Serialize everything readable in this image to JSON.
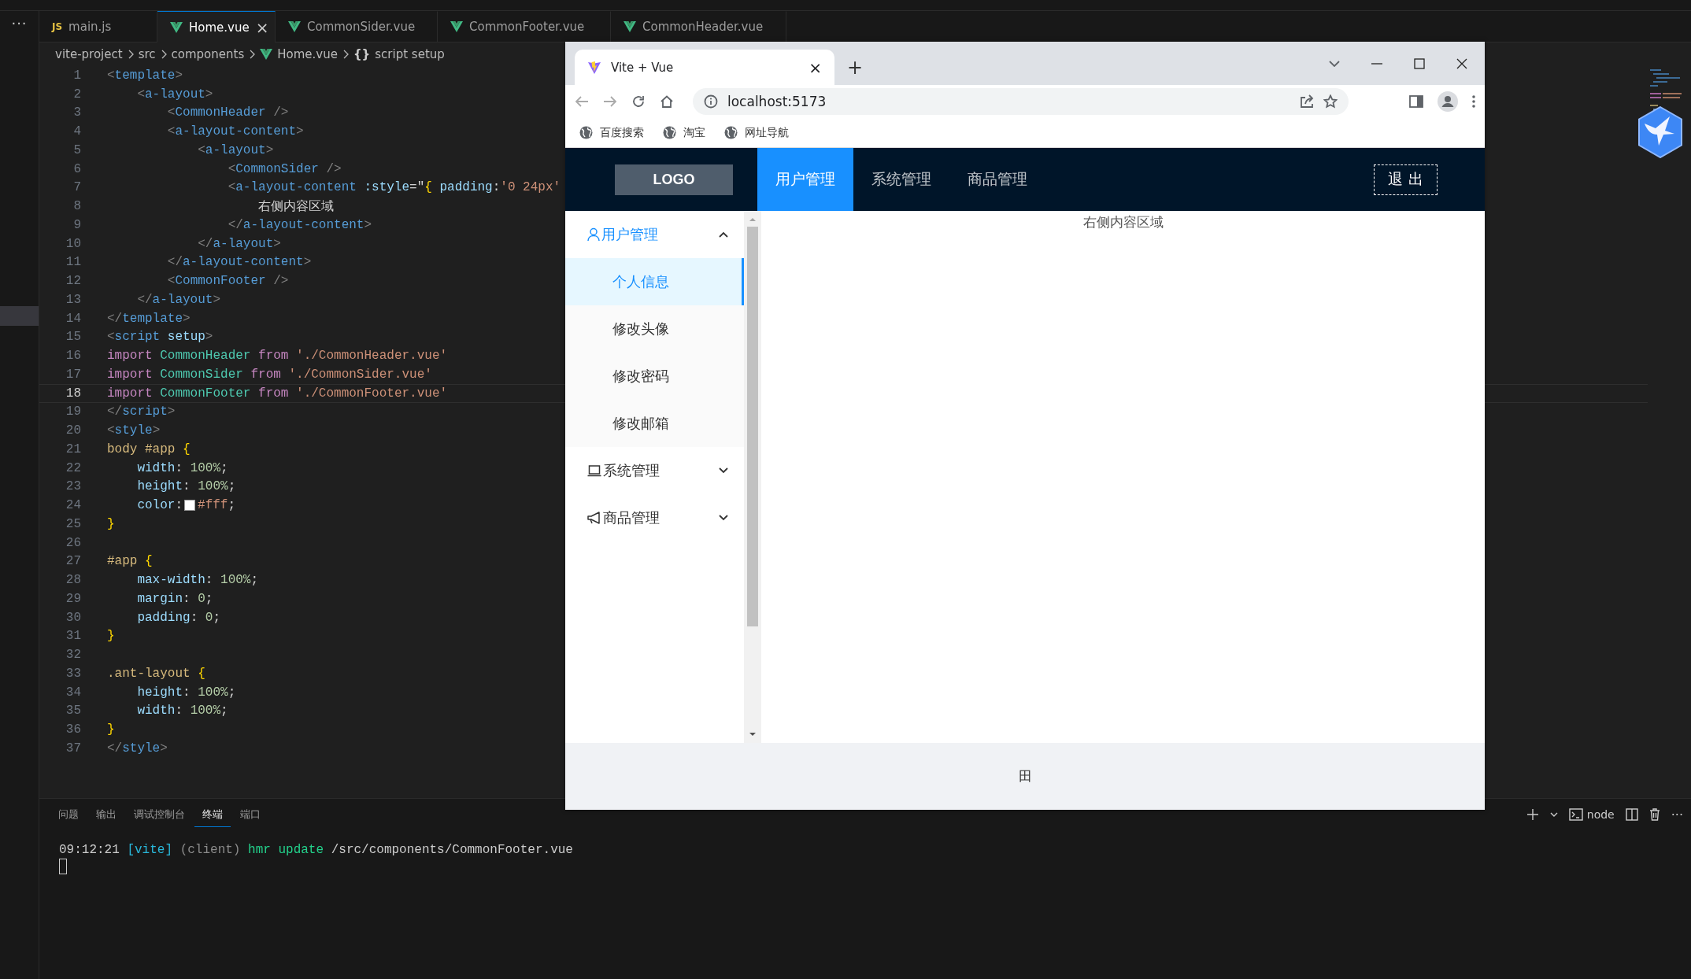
{
  "editor": {
    "more": "···",
    "tabs": [
      {
        "label": "main.js",
        "kind": "js",
        "icon": "JS",
        "selected": false
      },
      {
        "label": "Home.vue",
        "kind": "vue",
        "selected": true,
        "close": "×"
      },
      {
        "label": "CommonSider.vue",
        "kind": "vue",
        "selected": false
      },
      {
        "label": "CommonFooter.vue",
        "kind": "vue",
        "selected": false
      },
      {
        "label": "CommonHeader.vue",
        "kind": "vue",
        "selected": false
      }
    ],
    "breadcrumb": [
      {
        "label": "vite-project",
        "kind": "plain"
      },
      {
        "label": "src",
        "kind": "plain"
      },
      {
        "label": "components",
        "kind": "plain"
      },
      {
        "label": "Home.vue",
        "kind": "vue"
      },
      {
        "label": "script setup",
        "kind": "symbol",
        "icon": "{}"
      }
    ],
    "lines": [
      {
        "n": "1",
        "current": false,
        "tokens": [
          {
            "kind": "punct",
            "text": "<"
          },
          {
            "kind": "tag",
            "text": "template"
          },
          {
            "kind": "punct",
            "text": ">"
          }
        ]
      },
      {
        "n": "2",
        "current": false,
        "tokens": [
          {
            "kind": "punct",
            "text": "    <"
          },
          {
            "kind": "tag",
            "text": "a-layout"
          },
          {
            "kind": "punct",
            "text": ">"
          }
        ]
      },
      {
        "n": "3",
        "current": false,
        "tokens": [
          {
            "kind": "punct",
            "text": "        <"
          },
          {
            "kind": "tag",
            "text": "CommonHeader"
          },
          {
            "kind": "punct",
            "text": " />"
          }
        ]
      },
      {
        "n": "4",
        "current": false,
        "tokens": [
          {
            "kind": "punct",
            "text": "        <"
          },
          {
            "kind": "tag",
            "text": "a-layout-content"
          },
          {
            "kind": "punct",
            "text": ">"
          }
        ]
      },
      {
        "n": "5",
        "current": false,
        "tokens": [
          {
            "kind": "punct",
            "text": "            <"
          },
          {
            "kind": "tag",
            "text": "a-layout"
          },
          {
            "kind": "punct",
            "text": ">"
          }
        ]
      },
      {
        "n": "6",
        "current": false,
        "tokens": [
          {
            "kind": "punct",
            "text": "                <"
          },
          {
            "kind": "tag",
            "text": "CommonSider"
          },
          {
            "kind": "punct",
            "text": " />"
          }
        ]
      },
      {
        "n": "7",
        "current": false,
        "tokens": [
          {
            "kind": "punct",
            "text": "                <"
          },
          {
            "kind": "tag",
            "text": "a-layout-content"
          },
          {
            "kind": "attr",
            "text": " :style"
          },
          {
            "kind": "plain",
            "text": "=\""
          },
          {
            "kind": "brace",
            "text": "{"
          },
          {
            "kind": "attr",
            "text": " padding"
          },
          {
            "kind": "plain",
            "text": ":"
          },
          {
            "kind": "string",
            "text": "'0 24px'"
          }
        ]
      },
      {
        "n": "8",
        "current": false,
        "tokens": [
          {
            "kind": "plain",
            "text": "                    右侧内容区域"
          }
        ]
      },
      {
        "n": "9",
        "current": false,
        "tokens": [
          {
            "kind": "punct",
            "text": "                </"
          },
          {
            "kind": "tag",
            "text": "a-layout-content"
          },
          {
            "kind": "punct",
            "text": ">"
          }
        ]
      },
      {
        "n": "10",
        "current": false,
        "tokens": [
          {
            "kind": "punct",
            "text": "            </"
          },
          {
            "kind": "tag",
            "text": "a-layout"
          },
          {
            "kind": "punct",
            "text": ">"
          }
        ]
      },
      {
        "n": "11",
        "current": false,
        "tokens": [
          {
            "kind": "punct",
            "text": "        </"
          },
          {
            "kind": "tag",
            "text": "a-layout-content"
          },
          {
            "kind": "punct",
            "text": ">"
          }
        ]
      },
      {
        "n": "12",
        "current": false,
        "tokens": [
          {
            "kind": "punct",
            "text": "        <"
          },
          {
            "kind": "tag",
            "text": "CommonFooter"
          },
          {
            "kind": "punct",
            "text": " />"
          }
        ]
      },
      {
        "n": "13",
        "current": false,
        "tokens": [
          {
            "kind": "punct",
            "text": "    </"
          },
          {
            "kind": "tag",
            "text": "a-layout"
          },
          {
            "kind": "punct",
            "text": ">"
          }
        ]
      },
      {
        "n": "14",
        "current": false,
        "tokens": [
          {
            "kind": "punct",
            "text": "</"
          },
          {
            "kind": "tag",
            "text": "template"
          },
          {
            "kind": "punct",
            "text": ">"
          }
        ]
      },
      {
        "n": "15",
        "current": false,
        "tokens": [
          {
            "kind": "punct",
            "text": "<"
          },
          {
            "kind": "tag",
            "text": "script"
          },
          {
            "kind": "attr",
            "text": " setup"
          },
          {
            "kind": "punct",
            "text": ">"
          }
        ]
      },
      {
        "n": "16",
        "current": false,
        "tokens": [
          {
            "kind": "keyword",
            "text": "import"
          },
          {
            "kind": "var",
            "text": " CommonHeader"
          },
          {
            "kind": "keyword",
            "text": " from"
          },
          {
            "kind": "string",
            "text": " './CommonHeader.vue'"
          }
        ]
      },
      {
        "n": "17",
        "current": false,
        "tokens": [
          {
            "kind": "keyword",
            "text": "import"
          },
          {
            "kind": "var",
            "text": " CommonSider"
          },
          {
            "kind": "keyword",
            "text": " from"
          },
          {
            "kind": "string",
            "text": " './CommonSider.vue'"
          }
        ]
      },
      {
        "n": "18",
        "current": true,
        "tokens": [
          {
            "kind": "keyword",
            "text": "import"
          },
          {
            "kind": "var",
            "text": " CommonFooter"
          },
          {
            "kind": "keyword",
            "text": " from"
          },
          {
            "kind": "string",
            "text": " './CommonFooter.vue'"
          }
        ]
      },
      {
        "n": "19",
        "current": false,
        "tokens": [
          {
            "kind": "punct",
            "text": "</"
          },
          {
            "kind": "tag",
            "text": "script"
          },
          {
            "kind": "punct",
            "text": ">"
          }
        ]
      },
      {
        "n": "20",
        "current": false,
        "tokens": [
          {
            "kind": "punct",
            "text": "<"
          },
          {
            "kind": "tag",
            "text": "style"
          },
          {
            "kind": "punct",
            "text": ">"
          }
        ]
      },
      {
        "n": "21",
        "current": false,
        "tokens": [
          {
            "kind": "selector",
            "text": "body #app"
          },
          {
            "kind": "brace",
            "text": " {"
          }
        ]
      },
      {
        "n": "22",
        "current": false,
        "tokens": [
          {
            "kind": "attr",
            "text": "    width"
          },
          {
            "kind": "plain",
            "text": ":"
          },
          {
            "kind": "number",
            "text": " 100%"
          },
          {
            "kind": "plain",
            "text": ";"
          }
        ]
      },
      {
        "n": "23",
        "current": false,
        "tokens": [
          {
            "kind": "attr",
            "text": "    height"
          },
          {
            "kind": "plain",
            "text": ":"
          },
          {
            "kind": "number",
            "text": " 100%"
          },
          {
            "kind": "plain",
            "text": ";"
          }
        ]
      },
      {
        "n": "24",
        "current": false,
        "tokens": [
          {
            "kind": "attr",
            "text": "    color"
          },
          {
            "kind": "plain",
            "text": ":"
          },
          {
            "kind": "swatch",
            "color": "#ffffff"
          },
          {
            "kind": "string",
            "text": "#fff"
          },
          {
            "kind": "plain",
            "text": ";"
          }
        ]
      },
      {
        "n": "25",
        "current": false,
        "tokens": [
          {
            "kind": "brace",
            "text": "}"
          }
        ]
      },
      {
        "n": "26",
        "current": false
      },
      {
        "n": "27",
        "current": false,
        "tokens": [
          {
            "kind": "selector",
            "text": "#app"
          },
          {
            "kind": "brace",
            "text": " {"
          }
        ]
      },
      {
        "n": "28",
        "current": false,
        "tokens": [
          {
            "kind": "attr",
            "text": "    max-width"
          },
          {
            "kind": "plain",
            "text": ":"
          },
          {
            "kind": "number",
            "text": " 100%"
          },
          {
            "kind": "plain",
            "text": ";"
          }
        ]
      },
      {
        "n": "29",
        "current": false,
        "tokens": [
          {
            "kind": "attr",
            "text": "    margin"
          },
          {
            "kind": "plain",
            "text": ":"
          },
          {
            "kind": "number",
            "text": " 0"
          },
          {
            "kind": "plain",
            "text": ";"
          }
        ]
      },
      {
        "n": "30",
        "current": false,
        "tokens": [
          {
            "kind": "attr",
            "text": "    padding"
          },
          {
            "kind": "plain",
            "text": ":"
          },
          {
            "kind": "number",
            "text": " 0"
          },
          {
            "kind": "plain",
            "text": ";"
          }
        ]
      },
      {
        "n": "31",
        "current": false,
        "tokens": [
          {
            "kind": "brace",
            "text": "}"
          }
        ]
      },
      {
        "n": "32",
        "current": false
      },
      {
        "n": "33",
        "current": false,
        "tokens": [
          {
            "kind": "selector",
            "text": ".ant-layout"
          },
          {
            "kind": "brace",
            "text": " {"
          }
        ]
      },
      {
        "n": "34",
        "current": false,
        "tokens": [
          {
            "kind": "attr",
            "text": "    height"
          },
          {
            "kind": "plain",
            "text": ":"
          },
          {
            "kind": "number",
            "text": " 100%"
          },
          {
            "kind": "plain",
            "text": ";"
          }
        ]
      },
      {
        "n": "35",
        "current": false,
        "tokens": [
          {
            "kind": "attr",
            "text": "    width"
          },
          {
            "kind": "plain",
            "text": ":"
          },
          {
            "kind": "number",
            "text": " 100%"
          },
          {
            "kind": "plain",
            "text": ";"
          }
        ]
      },
      {
        "n": "36",
        "current": false,
        "tokens": [
          {
            "kind": "brace",
            "text": "}"
          }
        ]
      },
      {
        "n": "37",
        "current": false,
        "tokens": [
          {
            "kind": "punct",
            "text": "</"
          },
          {
            "kind": "tag",
            "text": "style"
          },
          {
            "kind": "punct",
            "text": ">"
          }
        ]
      }
    ]
  },
  "panel": {
    "tabs": [
      {
        "label": "问题",
        "selected": false
      },
      {
        "label": "输出",
        "selected": false
      },
      {
        "label": "调试控制台",
        "selected": false
      },
      {
        "label": "终端",
        "selected": true
      },
      {
        "label": "端口",
        "selected": false
      }
    ],
    "shell": "node",
    "more": "···",
    "output": [
      {
        "kind": "plain",
        "text": "09:12:21"
      },
      {
        "kind": "tag",
        "text": " [vite]"
      },
      {
        "kind": "muted",
        "text": " (client)"
      },
      {
        "kind": "action",
        "text": " hmr update"
      },
      {
        "kind": "plain",
        "text": " /src/components/CommonFooter.vue"
      }
    ]
  },
  "browser": {
    "tab": {
      "title": "Vite + Vue",
      "close": "×"
    },
    "new_tab": "+",
    "address": "localhost:5173",
    "bookmarks": [
      "百度搜索",
      "淘宝",
      "网址导航"
    ],
    "page": {
      "logo": "LOGO",
      "nav": [
        {
          "label": "用户管理",
          "selected": true
        },
        {
          "label": "系统管理",
          "selected": false
        },
        {
          "label": "商品管理",
          "selected": false
        }
      ],
      "logout": "退 出",
      "menu": [
        {
          "label": "用户管理",
          "kind": "user",
          "expanded": true,
          "selected": true,
          "children": [
            {
              "label": "个人信息",
              "selected": true
            },
            {
              "label": "修改头像",
              "selected": false
            },
            {
              "label": "修改密码",
              "selected": false
            },
            {
              "label": "修改邮箱",
              "selected": false
            }
          ]
        },
        {
          "label": "系统管理",
          "kind": "laptop",
          "expanded": false,
          "selected": false
        },
        {
          "label": "商品管理",
          "kind": "megaphone",
          "expanded": false,
          "selected": false
        }
      ],
      "content": "右侧内容区域",
      "footer": "田"
    }
  }
}
